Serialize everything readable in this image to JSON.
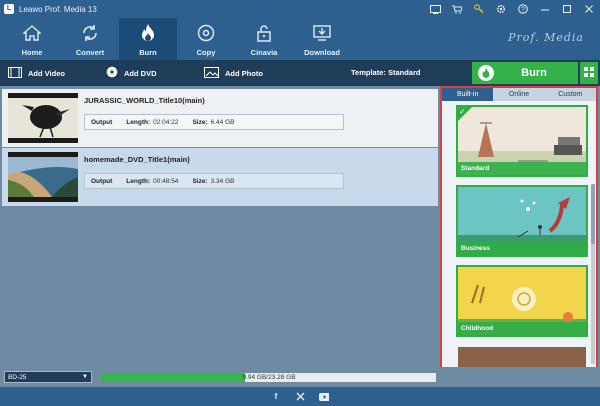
{
  "app": {
    "title": "Leawo Prof. Media 13",
    "brand_mark": "Prof. Media"
  },
  "window_buttons": [
    {
      "name": "media-icon"
    },
    {
      "name": "cart-icon"
    },
    {
      "name": "key-icon"
    },
    {
      "name": "gear-icon"
    },
    {
      "name": "help-icon"
    },
    {
      "name": "minimize-icon"
    },
    {
      "name": "maximize-icon"
    },
    {
      "name": "close-icon"
    }
  ],
  "nav": {
    "items": [
      {
        "label": "Home",
        "icon": "home-icon"
      },
      {
        "label": "Convert",
        "icon": "convert-icon"
      },
      {
        "label": "Burn",
        "icon": "flame-icon",
        "active": true
      },
      {
        "label": "Copy",
        "icon": "disc-icon"
      },
      {
        "label": "Cinavia",
        "icon": "unlock-icon"
      },
      {
        "label": "Download",
        "icon": "download-icon"
      }
    ]
  },
  "toolbar": {
    "add_video": "Add Video",
    "add_dvd": "Add DVD",
    "add_photo": "Add Photo",
    "template_label": "Template: Standard",
    "burn_label": "Burn"
  },
  "list": {
    "items": [
      {
        "title": "JURASSIC_WORLD_Title10(main)",
        "output_label": "Output",
        "length_label": "Length:",
        "length": "02:04:22",
        "size_label": "Size:",
        "size": "6.44 GB"
      },
      {
        "title": "homemade_DVD_Title1(main)",
        "output_label": "Output",
        "length_label": "Length:",
        "length": "00:48:54",
        "size_label": "Size:",
        "size": "3.34 GB"
      }
    ]
  },
  "templates_panel": {
    "tabs": [
      {
        "label": "Built-in",
        "active": true
      },
      {
        "label": "Online"
      },
      {
        "label": "Custom"
      }
    ],
    "templates": [
      {
        "label": "Standard",
        "selected": true
      },
      {
        "label": "Business"
      },
      {
        "label": "Childhood"
      },
      {
        "label": ""
      }
    ]
  },
  "bottom": {
    "disc_type": "BD-25",
    "usage_text": "9.94 GB/23.28 GB",
    "usage_fraction": 0.427
  },
  "footer": {
    "social": [
      "facebook-icon",
      "x-icon",
      "youtube-icon"
    ]
  },
  "colors": {
    "accent": "#2d5f8f",
    "burn_green": "#34b248",
    "highlight_red": "#d84040"
  }
}
